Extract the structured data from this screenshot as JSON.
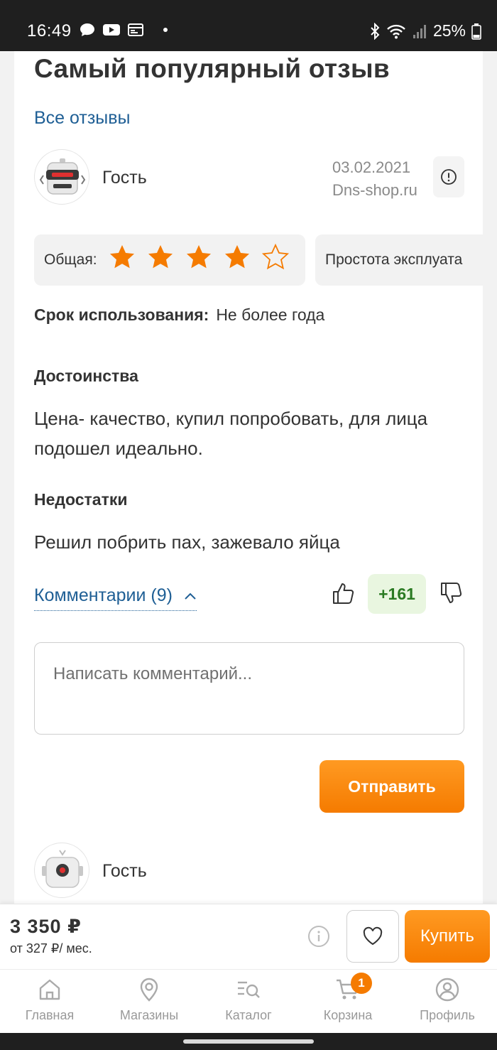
{
  "status_bar": {
    "time": "16:49",
    "battery": "25%"
  },
  "review": {
    "section_title": "Самый популярный отзыв",
    "all_reviews_link": "Все отзывы",
    "author": "Гость",
    "date": "03.02.2021",
    "source": "Dns-shop.ru",
    "overall_label": "Общая:",
    "overall_rating": 4,
    "overall_max": 5,
    "ease_label": "Простота эксплуата",
    "usage_label": "Срок использования:",
    "usage_value": "Не более года",
    "pros_title": "Достоинства",
    "pros_text": "Цена- качество, купил попробовать, для лица подошел идеально.",
    "cons_title": "Недостатки",
    "cons_text": "Решил побрить пах, зажевало яйца",
    "comments_link": "Комментарии (9)",
    "vote_count": "+161",
    "comment_placeholder": "Написать комментарий...",
    "send_button": "Отправить"
  },
  "next_comment": {
    "author": "Гость"
  },
  "purchase": {
    "price": "3 350 ₽",
    "credit": "от 327 ₽/ мес.",
    "buy_button": "Купить"
  },
  "nav": {
    "items": [
      {
        "label": "Главная",
        "icon": "home-icon"
      },
      {
        "label": "Магазины",
        "icon": "map-pin-icon"
      },
      {
        "label": "Каталог",
        "icon": "catalog-search-icon"
      },
      {
        "label": "Корзина",
        "icon": "cart-icon",
        "badge": "1"
      },
      {
        "label": "Профиль",
        "icon": "profile-icon"
      }
    ]
  },
  "colors": {
    "accent": "#f57b00",
    "link": "#1f5f95",
    "vote_bg": "#e9f6e0",
    "vote_text": "#2a7a22"
  }
}
